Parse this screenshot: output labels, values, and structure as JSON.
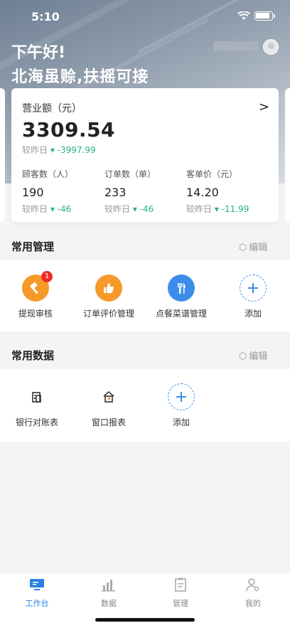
{
  "status_bar": {
    "time": "5:10"
  },
  "header": {
    "greeting": "下午好!",
    "store_name": "北海虽赊,扶摇可接"
  },
  "revenue_card": {
    "label": "营业额（元）",
    "value": "3309.54",
    "compare_label": "较昨日",
    "compare_value": "-3997.99",
    "metrics": [
      {
        "label": "顾客数（人）",
        "value": "190",
        "compare_label": "较昨日",
        "compare_value": "-46"
      },
      {
        "label": "订单数（单）",
        "value": "233",
        "compare_label": "较昨日",
        "compare_value": "-46"
      },
      {
        "label": "客单价（元）",
        "value": "14.20",
        "compare_label": "较昨日",
        "compare_value": "-11.99"
      }
    ]
  },
  "common_manage": {
    "title": "常用管理",
    "edit_label": "编辑",
    "items": [
      {
        "label": "提现审核",
        "icon": "hammer-icon",
        "badge": "1"
      },
      {
        "label": "订单评价管理",
        "icon": "thumbs-up-icon"
      },
      {
        "label": "点餐菜谱管理",
        "icon": "fork-knife-icon"
      },
      {
        "label": "添加",
        "icon": "plus-icon"
      }
    ]
  },
  "common_data": {
    "title": "常用数据",
    "edit_label": "编辑",
    "items": [
      {
        "label": "银行对账表",
        "icon": "bank-building-icon"
      },
      {
        "label": "窗口报表",
        "icon": "house-icon"
      },
      {
        "label": "添加",
        "icon": "plus-icon"
      }
    ]
  },
  "tabbar": {
    "items": [
      {
        "label": "工作台",
        "icon": "monitor-icon",
        "active": true
      },
      {
        "label": "数据",
        "icon": "bar-chart-icon"
      },
      {
        "label": "管理",
        "icon": "clipboard-icon"
      },
      {
        "label": "我的",
        "icon": "user-gear-icon"
      }
    ]
  },
  "colors": {
    "accent": "#2b82e0",
    "orange": "#f59a2a",
    "down": "#27b38a",
    "badge": "#ee2b2b"
  }
}
